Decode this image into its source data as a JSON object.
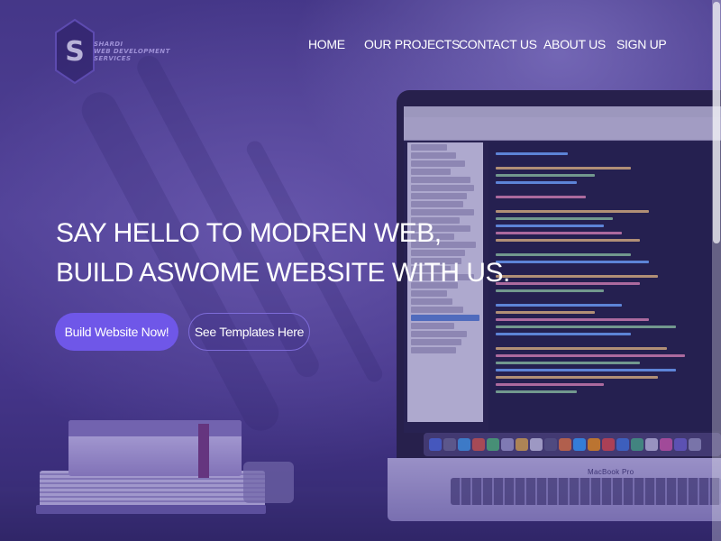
{
  "logo": {
    "letter": "S",
    "line1": "SHARDI",
    "line2": "WEB DEVELOPMENT",
    "line3": "SERVICES"
  },
  "nav": {
    "items": [
      {
        "label": "HOME"
      },
      {
        "label": "OUR PROJECTS"
      },
      {
        "label": "CONTACT US"
      },
      {
        "label": "ABOUT US"
      },
      {
        "label": "SIGN UP"
      }
    ]
  },
  "hero": {
    "line1": "SAY HELLO TO MODREN WEB,",
    "line2": "BUILD ASWOME WEBSITE WITH US."
  },
  "buttons": {
    "primary": "Build Website Now!",
    "secondary": "See Templates Here"
  },
  "laptop": {
    "brand": "MacBook Pro"
  },
  "colors": {
    "accent": "#6f57e8",
    "overlay": "#3c2d8c",
    "text": "#ffffff"
  }
}
